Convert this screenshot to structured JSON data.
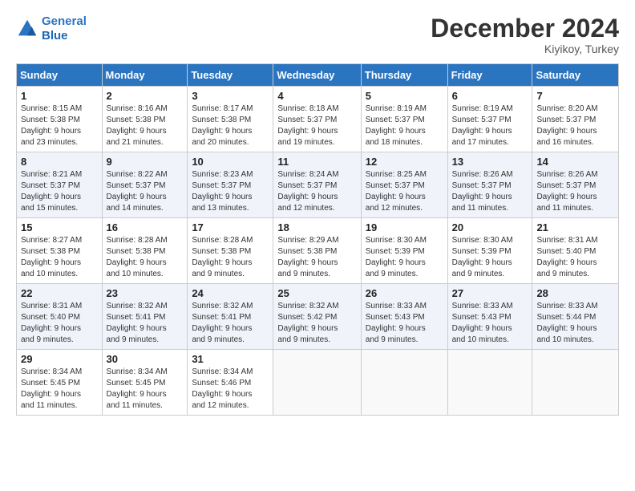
{
  "logo": {
    "line1": "General",
    "line2": "Blue"
  },
  "title": "December 2024",
  "location": "Kiyikoy, Turkey",
  "days_of_week": [
    "Sunday",
    "Monday",
    "Tuesday",
    "Wednesday",
    "Thursday",
    "Friday",
    "Saturday"
  ],
  "weeks": [
    [
      {
        "day": "1",
        "info": "Sunrise: 8:15 AM\nSunset: 5:38 PM\nDaylight: 9 hours\nand 23 minutes."
      },
      {
        "day": "2",
        "info": "Sunrise: 8:16 AM\nSunset: 5:38 PM\nDaylight: 9 hours\nand 21 minutes."
      },
      {
        "day": "3",
        "info": "Sunrise: 8:17 AM\nSunset: 5:38 PM\nDaylight: 9 hours\nand 20 minutes."
      },
      {
        "day": "4",
        "info": "Sunrise: 8:18 AM\nSunset: 5:37 PM\nDaylight: 9 hours\nand 19 minutes."
      },
      {
        "day": "5",
        "info": "Sunrise: 8:19 AM\nSunset: 5:37 PM\nDaylight: 9 hours\nand 18 minutes."
      },
      {
        "day": "6",
        "info": "Sunrise: 8:19 AM\nSunset: 5:37 PM\nDaylight: 9 hours\nand 17 minutes."
      },
      {
        "day": "7",
        "info": "Sunrise: 8:20 AM\nSunset: 5:37 PM\nDaylight: 9 hours\nand 16 minutes."
      }
    ],
    [
      {
        "day": "8",
        "info": "Sunrise: 8:21 AM\nSunset: 5:37 PM\nDaylight: 9 hours\nand 15 minutes."
      },
      {
        "day": "9",
        "info": "Sunrise: 8:22 AM\nSunset: 5:37 PM\nDaylight: 9 hours\nand 14 minutes."
      },
      {
        "day": "10",
        "info": "Sunrise: 8:23 AM\nSunset: 5:37 PM\nDaylight: 9 hours\nand 13 minutes."
      },
      {
        "day": "11",
        "info": "Sunrise: 8:24 AM\nSunset: 5:37 PM\nDaylight: 9 hours\nand 12 minutes."
      },
      {
        "day": "12",
        "info": "Sunrise: 8:25 AM\nSunset: 5:37 PM\nDaylight: 9 hours\nand 12 minutes."
      },
      {
        "day": "13",
        "info": "Sunrise: 8:26 AM\nSunset: 5:37 PM\nDaylight: 9 hours\nand 11 minutes."
      },
      {
        "day": "14",
        "info": "Sunrise: 8:26 AM\nSunset: 5:37 PM\nDaylight: 9 hours\nand 11 minutes."
      }
    ],
    [
      {
        "day": "15",
        "info": "Sunrise: 8:27 AM\nSunset: 5:38 PM\nDaylight: 9 hours\nand 10 minutes."
      },
      {
        "day": "16",
        "info": "Sunrise: 8:28 AM\nSunset: 5:38 PM\nDaylight: 9 hours\nand 10 minutes."
      },
      {
        "day": "17",
        "info": "Sunrise: 8:28 AM\nSunset: 5:38 PM\nDaylight: 9 hours\nand 9 minutes."
      },
      {
        "day": "18",
        "info": "Sunrise: 8:29 AM\nSunset: 5:38 PM\nDaylight: 9 hours\nand 9 minutes."
      },
      {
        "day": "19",
        "info": "Sunrise: 8:30 AM\nSunset: 5:39 PM\nDaylight: 9 hours\nand 9 minutes."
      },
      {
        "day": "20",
        "info": "Sunrise: 8:30 AM\nSunset: 5:39 PM\nDaylight: 9 hours\nand 9 minutes."
      },
      {
        "day": "21",
        "info": "Sunrise: 8:31 AM\nSunset: 5:40 PM\nDaylight: 9 hours\nand 9 minutes."
      }
    ],
    [
      {
        "day": "22",
        "info": "Sunrise: 8:31 AM\nSunset: 5:40 PM\nDaylight: 9 hours\nand 9 minutes."
      },
      {
        "day": "23",
        "info": "Sunrise: 8:32 AM\nSunset: 5:41 PM\nDaylight: 9 hours\nand 9 minutes."
      },
      {
        "day": "24",
        "info": "Sunrise: 8:32 AM\nSunset: 5:41 PM\nDaylight: 9 hours\nand 9 minutes."
      },
      {
        "day": "25",
        "info": "Sunrise: 8:32 AM\nSunset: 5:42 PM\nDaylight: 9 hours\nand 9 minutes."
      },
      {
        "day": "26",
        "info": "Sunrise: 8:33 AM\nSunset: 5:43 PM\nDaylight: 9 hours\nand 9 minutes."
      },
      {
        "day": "27",
        "info": "Sunrise: 8:33 AM\nSunset: 5:43 PM\nDaylight: 9 hours\nand 10 minutes."
      },
      {
        "day": "28",
        "info": "Sunrise: 8:33 AM\nSunset: 5:44 PM\nDaylight: 9 hours\nand 10 minutes."
      }
    ],
    [
      {
        "day": "29",
        "info": "Sunrise: 8:34 AM\nSunset: 5:45 PM\nDaylight: 9 hours\nand 11 minutes."
      },
      {
        "day": "30",
        "info": "Sunrise: 8:34 AM\nSunset: 5:45 PM\nDaylight: 9 hours\nand 11 minutes."
      },
      {
        "day": "31",
        "info": "Sunrise: 8:34 AM\nSunset: 5:46 PM\nDaylight: 9 hours\nand 12 minutes."
      },
      null,
      null,
      null,
      null
    ]
  ]
}
